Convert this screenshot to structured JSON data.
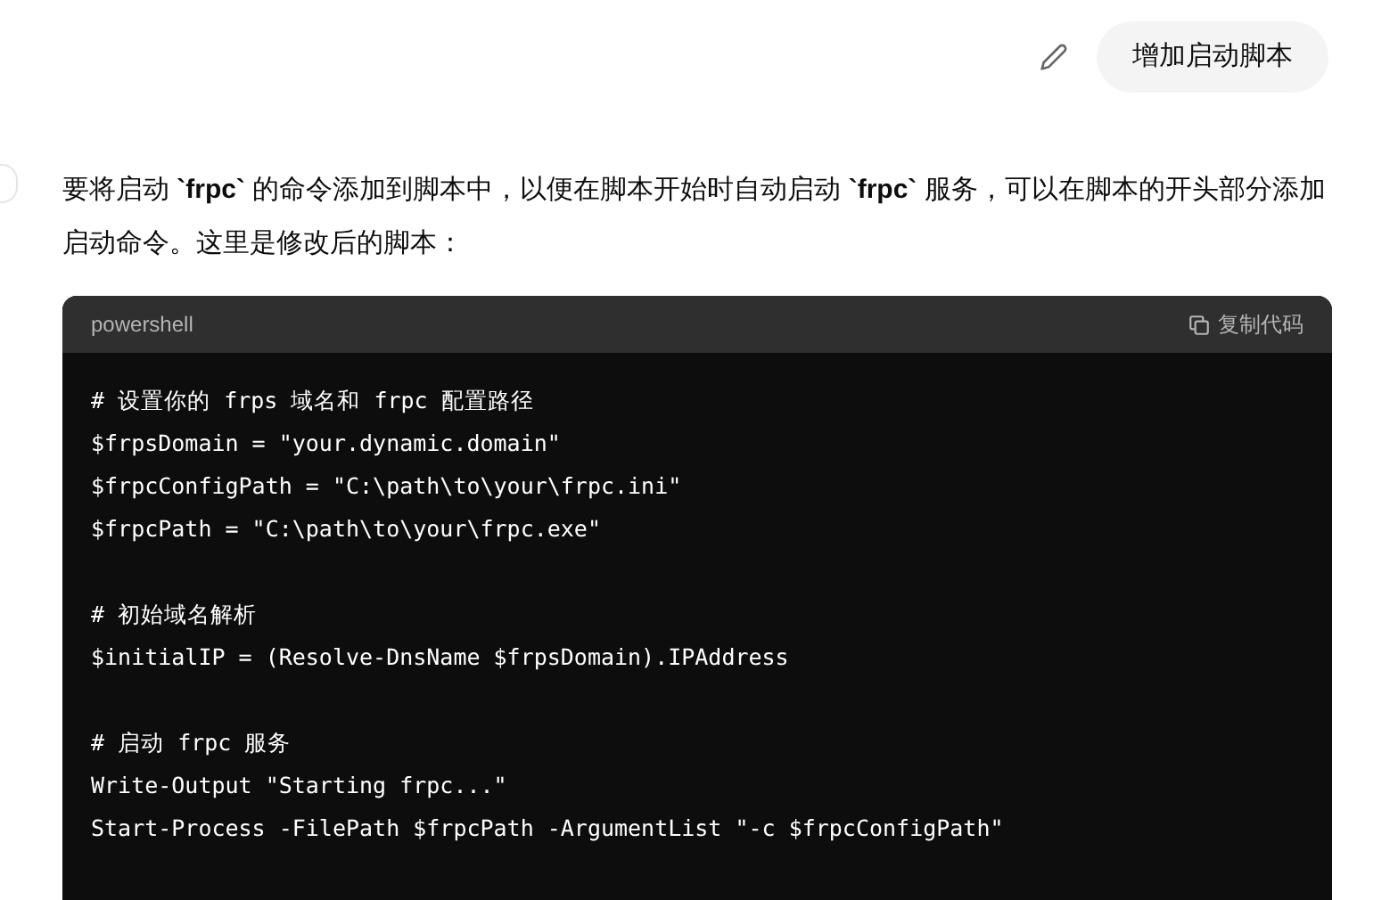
{
  "user_message": {
    "text": "增加启动脚本"
  },
  "answer": {
    "paragraph": "要将启动 **`frpc`** 的命令添加到脚本中，以便在脚本开始时自动启动 **`frpc`** 服务，可以在脚本的开头部分添加启动命令。这里是修改后的脚本：",
    "code_block": {
      "language": "powershell",
      "copy_label": "复制代码",
      "groups": [
        {
          "lines": [
            "# 设置你的 frps 域名和 frpc 配置路径",
            "$frpsDomain = \"your.dynamic.domain\"",
            "$frpcConfigPath = \"C:\\path\\to\\your\\frpc.ini\"",
            "$frpcPath = \"C:\\path\\to\\your\\frpc.exe\""
          ]
        },
        {
          "lines": [
            "# 初始域名解析",
            "$initialIP = (Resolve-DnsName $frpsDomain).IPAddress"
          ]
        },
        {
          "lines": [
            "# 启动 frpc 服务",
            "Write-Output \"Starting frpc...\"",
            "Start-Process -FilePath $frpcPath -ArgumentList \"-c $frpcConfigPath\""
          ]
        }
      ]
    }
  }
}
